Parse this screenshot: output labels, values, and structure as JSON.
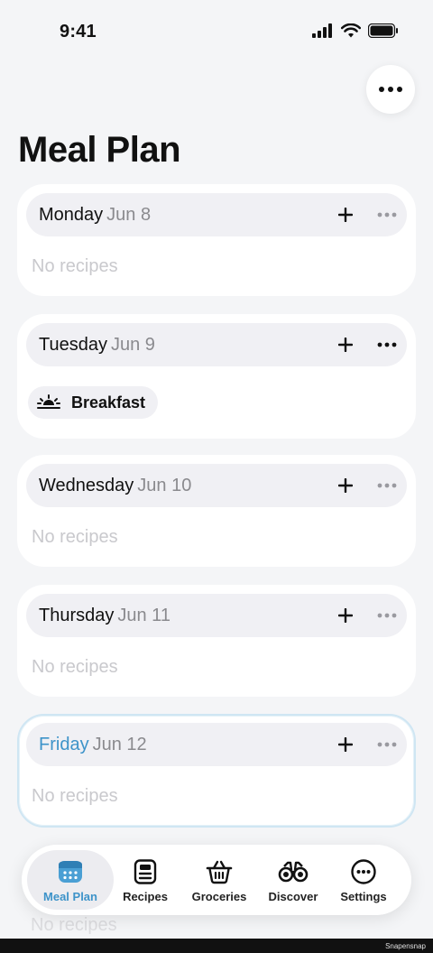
{
  "status_bar": {
    "time": "9:41"
  },
  "header": {
    "title": "Meal Plan"
  },
  "days": [
    {
      "name": "Monday",
      "date": "Jun 8",
      "empty_text": "No recipes",
      "is_today": false
    },
    {
      "name": "Tuesday",
      "date": "Jun 9",
      "is_today": false,
      "meals": [
        {
          "label": "Breakfast",
          "icon": "sunrise-icon"
        }
      ]
    },
    {
      "name": "Wednesday",
      "date": "Jun 10",
      "empty_text": "No recipes",
      "is_today": false
    },
    {
      "name": "Thursday",
      "date": "Jun 11",
      "empty_text": "No recipes",
      "is_today": false
    },
    {
      "name": "Friday",
      "date": "Jun 12",
      "empty_text": "No recipes",
      "is_today": true
    }
  ],
  "background_peek": {
    "text": "No recipes"
  },
  "tab_bar": {
    "tabs": [
      {
        "label": "Meal Plan",
        "icon": "calendar-icon",
        "active": true
      },
      {
        "label": "Recipes",
        "icon": "recipe-card-icon",
        "active": false
      },
      {
        "label": "Groceries",
        "icon": "basket-icon",
        "active": false
      },
      {
        "label": "Discover",
        "icon": "binoculars-icon",
        "active": false
      },
      {
        "label": "Settings",
        "icon": "ellipsis-circle-icon",
        "active": false
      }
    ]
  },
  "colors": {
    "accent": "#3d93c9",
    "placeholder": "#c9c9cd",
    "date": "#8a8a8e",
    "header_bg": "#f0f0f4"
  },
  "watermark": "Snapensnap"
}
